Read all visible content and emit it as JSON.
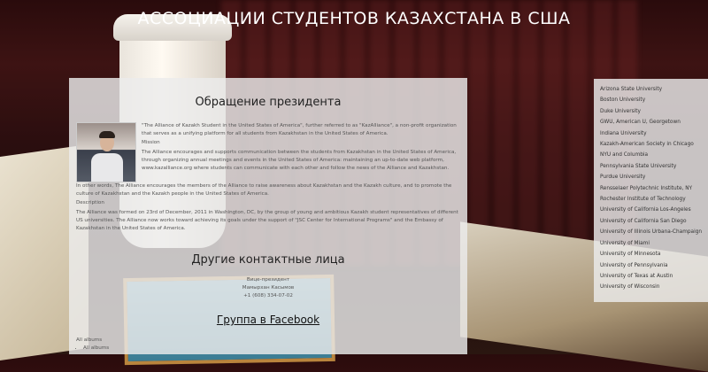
{
  "site_title": "АССОЦИАЦИИ СТУДЕНТОВ КАЗАХСТАНА В США",
  "president": {
    "heading": "Обращение президента",
    "intro": "\"The Alliance of Kazakh Student in the United States of America\", further referred to as \"KazAlliance\", a non-profit organization that serves as a unifying platform for all students from Kazakhstan in the United States of America.",
    "mission_label": "Mission",
    "mission_text": "The Alliance encourages and supports communication between the students from Kazakhstan in the United States of America, through organizing annual meetings and events in the United States of America: maintaining an up-to-date web platform, www.kazalliance.org where students can communicate with each other and follow the news of the Alliance and Kazakhstan.",
    "mission_text_2": "In other words, The Alliance encourages the members of the Alliance to raise awareness about Kazakhstan and the Kazakh culture, and to promote the culture of Kazakhstan and the Kazakh people in the United States of America.",
    "description_label": "Description",
    "description_text": "The Alliance was formed on 23rd of December, 2011 in Washington, DC, by the group of young and ambitious Kazakh student representatives of different US universities. The Alliance now works toward achieving its goals under the support of \"JSC Center for International Programs\" and the Embassy of Kazakhstan in the United States of America."
  },
  "contacts": {
    "heading": "Другие контактные лица",
    "role": "Вице-президент",
    "name": "Мамырхан Касымов",
    "phone": "+1 (608) 334-07-02"
  },
  "facebook_link": "Группа в Facebook",
  "albums": {
    "label": "All albums",
    "items": [
      "All albums"
    ]
  },
  "universities": [
    "Arizona State University",
    "Boston University",
    "Duke University",
    "GWU, American U, Georgetown",
    "Indiana University",
    "Kazakh-American Society in Chicago",
    "NYU and Columbia",
    "Pennsylvania State University",
    "Purdue University",
    "Rensselaer Polytechnic Institute, NY",
    "Rochester Institute of Technology",
    "University of California Los-Angeles",
    "University of California San Diego",
    "University of Illinois Urbana-Champaign",
    "University of Miami",
    "University of Minnesota",
    "University of Pennsylvania",
    "University of Texas at Austin",
    "University of Wisconsin"
  ]
}
